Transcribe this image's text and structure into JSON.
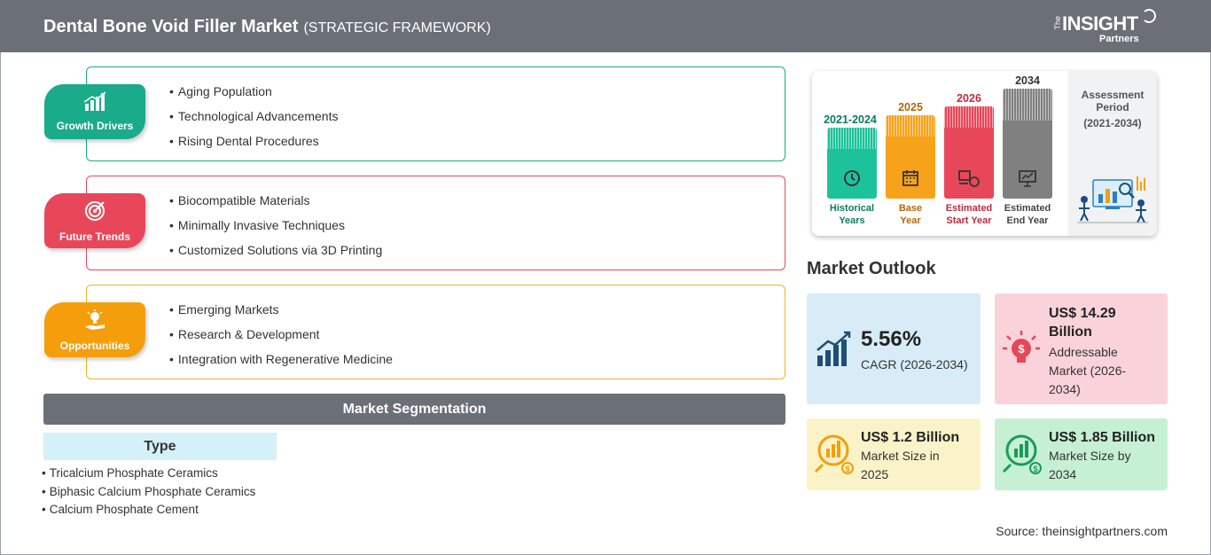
{
  "header": {
    "title": "Dental Bone Void Filler Market",
    "subtitle": "(STRATEGIC FRAMEWORK)",
    "logo_the": "The",
    "logo_main": "INSIGHT",
    "logo_partners": "Partners"
  },
  "framework": [
    {
      "label": "Growth Drivers",
      "icon": "growth-chart-icon",
      "color": "#1aab8a",
      "items": [
        "Aging Population",
        "Technological Advancements",
        "Rising Dental Procedures"
      ]
    },
    {
      "label": "Future Trends",
      "icon": "target-icon",
      "color": "#e8475a",
      "items": [
        "Biocompatible Materials",
        "Minimally Invasive Techniques",
        "Customized Solutions via 3D Printing"
      ]
    },
    {
      "label": "Opportunities",
      "icon": "lightbulb-hand-icon",
      "color": "#f59e0b",
      "items": [
        "Emerging Markets",
        "Research & Development",
        "Integration with Regenerative Medicine"
      ]
    }
  ],
  "segmentation": {
    "title": "Market Segmentation",
    "type_label": "Type",
    "items": [
      "Tricalcium Phosphate Ceramics",
      "Biphasic Calcium Phosphate Ceramics",
      "Calcium Phosphate Cement"
    ]
  },
  "timeline": {
    "periods": [
      {
        "year": "2021-2024",
        "caption_line1": "Historical",
        "caption_line2": "Years",
        "color": "#1cc39a",
        "text_color": "#0e7a5f",
        "icon": "history-icon"
      },
      {
        "year": "2025",
        "caption_line1": "Base",
        "caption_line2": "Year",
        "color": "#f7a21b",
        "text_color": "#b3660b",
        "icon": "calendar-icon"
      },
      {
        "year": "2026",
        "caption_line1": "Estimated",
        "caption_line2": "Start Year",
        "color": "#e8475a",
        "text_color": "#c2293c",
        "icon": "start-icon"
      },
      {
        "year": "2034",
        "caption_line1": "Estimated",
        "caption_line2": "End Year",
        "color": "#808080",
        "text_color": "#444444",
        "icon": "presentation-icon"
      }
    ],
    "assessment_title_line1": "Assessment",
    "assessment_title_line2": "Period",
    "assessment_range": "(2021-2034)"
  },
  "outlook": {
    "title": "Market Outlook",
    "cagr_value": "5.56%",
    "cagr_label": "CAGR (2026-2034)",
    "addressable_value_line1": "US$ 14.29",
    "addressable_value_line2": "Billion",
    "addressable_label_line1": "Addressable",
    "addressable_label_line2": "Market (2026-",
    "addressable_label_line3": "2034)",
    "size2025_value": "US$ 1.2 Billion",
    "size2025_label_line1": "Market Size in",
    "size2025_label_line2": "2025",
    "size2034_value": "US$ 1.85 Billion",
    "size2034_label_line1": "Market Size by",
    "size2034_label_line2": "2034"
  },
  "source": "Source: theinsightpartners.com"
}
